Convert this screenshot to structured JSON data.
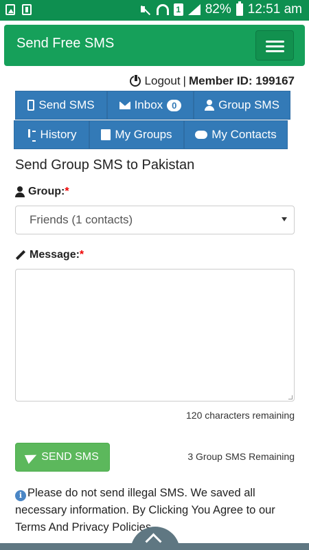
{
  "status_bar": {
    "battery": "82%",
    "time": "12:51 am",
    "sim_slot": "1"
  },
  "navbar": {
    "brand": "Send Free SMS"
  },
  "member": {
    "logout_label": "Logout",
    "separator": "|",
    "member_id_label": "Member ID: 199167"
  },
  "tabs": [
    {
      "label": "Send SMS",
      "icon": "mobile-phone-icon"
    },
    {
      "label": "Inbox",
      "icon": "envelope-icon",
      "badge": "0"
    },
    {
      "label": "Group SMS",
      "icon": "user-icon"
    },
    {
      "label": "History",
      "icon": "sort-icon"
    },
    {
      "label": "My Groups",
      "icon": "book-icon"
    },
    {
      "label": "My Contacts",
      "icon": "cloud-download-icon"
    }
  ],
  "form": {
    "heading": "Send Group SMS to Pakistan",
    "group_label": "Group:",
    "group_selected": "Friends (1 contacts)",
    "message_label": "Message:",
    "required_mark": "*",
    "chars_remaining": "120 characters remaining",
    "send_button": "SEND SMS",
    "group_sms_remaining": "3 Group SMS Remaining",
    "notice": "Please do not send illegal SMS. We saved all necessary information. By Clicking You Agree to our Terms And Privacy Policies"
  },
  "colors": {
    "status_bar": "#0e8f50",
    "navbar": "#16a05a",
    "tab": "#337ab7",
    "send_button": "#5cb85c",
    "required": "#ee0000"
  }
}
